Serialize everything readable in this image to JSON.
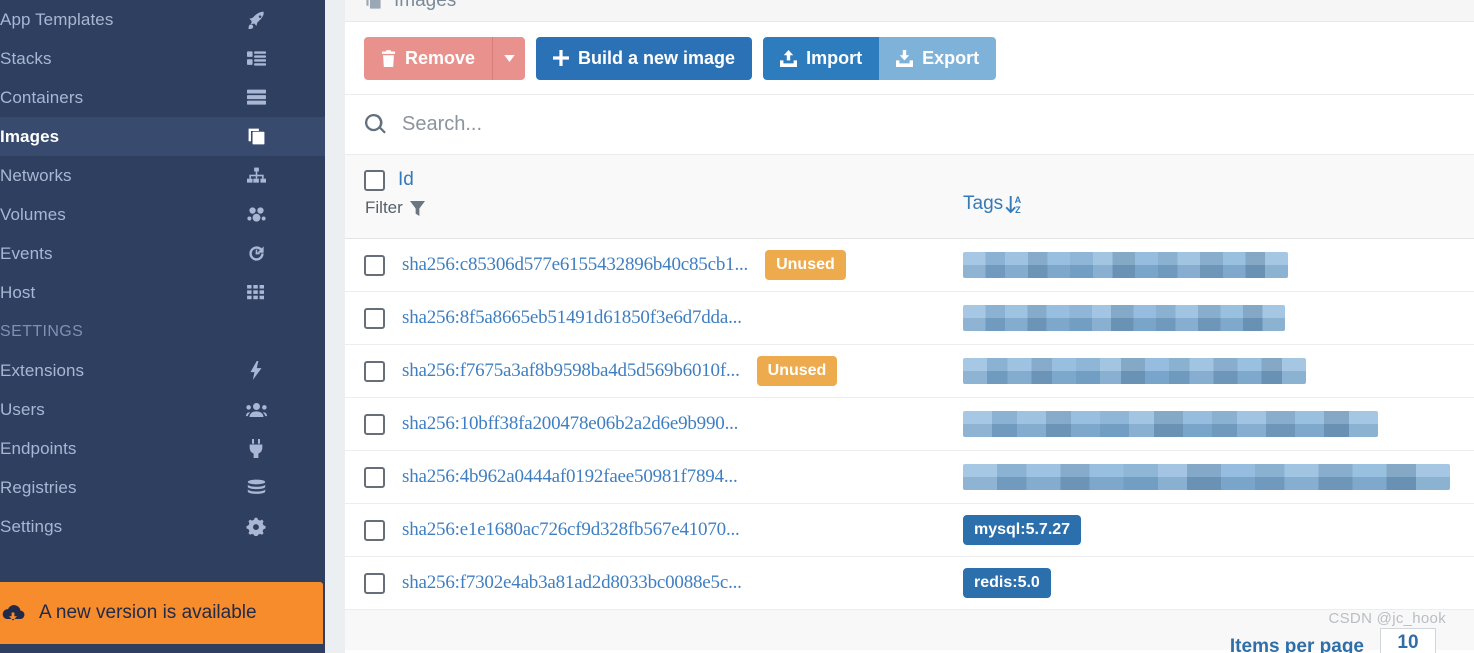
{
  "sidebar": {
    "items": [
      {
        "label": "App Templates",
        "icon": "rocket-icon",
        "active": false
      },
      {
        "label": "Stacks",
        "icon": "stacks-icon",
        "active": false
      },
      {
        "label": "Containers",
        "icon": "containers-icon",
        "active": false
      },
      {
        "label": "Images",
        "icon": "images-icon",
        "active": true
      },
      {
        "label": "Networks",
        "icon": "networks-icon",
        "active": false
      },
      {
        "label": "Volumes",
        "icon": "volumes-icon",
        "active": false
      },
      {
        "label": "Events",
        "icon": "history-icon",
        "active": false
      },
      {
        "label": "Host",
        "icon": "grid-icon",
        "active": false
      }
    ],
    "section_label": "SETTINGS",
    "settings_items": [
      {
        "label": "Extensions",
        "icon": "bolt-icon"
      },
      {
        "label": "Users",
        "icon": "users-icon"
      },
      {
        "label": "Endpoints",
        "icon": "plug-icon"
      },
      {
        "label": "Registries",
        "icon": "database-icon"
      },
      {
        "label": "Settings",
        "icon": "gears-icon"
      }
    ],
    "update_banner": {
      "label": "A new version is available",
      "icon": "cloud-download-icon",
      "background": "#f78c2c"
    },
    "background": "#2f3f5f",
    "active_background": "#384a6d"
  },
  "page": {
    "card_title": "Images",
    "card_title_icon": "images-icon"
  },
  "toolbar": {
    "remove_label": "Remove",
    "remove_icon": "trash-icon",
    "remove_caret_icon": "caret-down-icon",
    "build_label": "Build a new image",
    "build_icon": "plus-icon",
    "import_label": "Import",
    "import_icon": "upload-icon",
    "export_label": "Export",
    "export_icon": "download-icon",
    "colors": {
      "danger": "#e9918c",
      "primary": "#2a72b5",
      "import": "#2d7cbe",
      "export": "#7fb2d9"
    }
  },
  "search": {
    "placeholder": "Search...",
    "value": "",
    "icon": "search-icon"
  },
  "table": {
    "columns": {
      "id_label": "Id",
      "filter_label": "Filter",
      "filter_icon": "funnel-icon",
      "tags_label": "Tags",
      "tags_sort_icon": "sort-alpha-down-icon"
    },
    "select_all_checked": false,
    "rows": [
      {
        "id": "sha256:c85306d577e6155432896b40c85cb1...",
        "checked": false,
        "unused": true,
        "unused_label": "Unused",
        "tag_type": "redacted",
        "tag_width": 325,
        "tag_text": ""
      },
      {
        "id": "sha256:8f5a8665eb51491d61850f3e6d7dda...",
        "checked": false,
        "unused": false,
        "unused_label": "",
        "tag_type": "redacted",
        "tag_width": 322,
        "tag_text": ""
      },
      {
        "id": "sha256:f7675a3af8b9598ba4d5d569b6010f...",
        "checked": false,
        "unused": true,
        "unused_label": "Unused",
        "tag_type": "redacted",
        "tag_width": 343,
        "tag_text": ""
      },
      {
        "id": "sha256:10bff38fa200478e06b2a2d6e9b990...",
        "checked": false,
        "unused": false,
        "unused_label": "",
        "tag_type": "redacted",
        "tag_width": 415,
        "tag_text": ""
      },
      {
        "id": "sha256:4b962a0444af0192faee50981f7894...",
        "checked": false,
        "unused": false,
        "unused_label": "",
        "tag_type": "redacted",
        "tag_width": 487,
        "tag_text": ""
      },
      {
        "id": "sha256:e1e1680ac726cf9d328fb567e41070...",
        "checked": false,
        "unused": false,
        "unused_label": "",
        "tag_type": "badge",
        "tag_width": 0,
        "tag_text": "mysql:5.7.27"
      },
      {
        "id": "sha256:f7302e4ab3a81ad2d8033bc0088e5c...",
        "checked": false,
        "unused": false,
        "unused_label": "",
        "tag_type": "badge",
        "tag_width": 0,
        "tag_text": "redis:5.0"
      }
    ]
  },
  "footer": {
    "items_per_page_label": "Items per page",
    "items_per_page_value": "10"
  },
  "watermark": "CSDN @jc_hook"
}
